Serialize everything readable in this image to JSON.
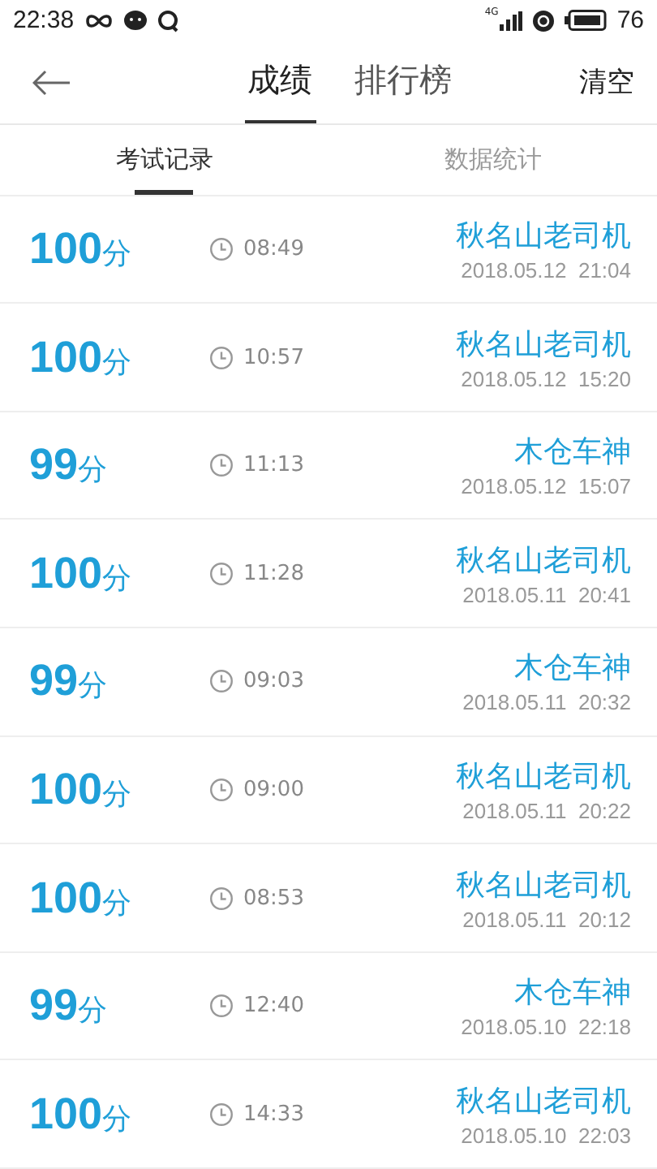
{
  "status_bar": {
    "time": "22:38",
    "network": "4G",
    "battery": "76"
  },
  "header": {
    "tabs": [
      {
        "label": "成绩",
        "selected": true
      },
      {
        "label": "排行榜",
        "selected": false
      }
    ],
    "action": "清空"
  },
  "subtabs": [
    {
      "label": "考试记录",
      "selected": true
    },
    {
      "label": "数据统计",
      "selected": false
    }
  ],
  "records": [
    {
      "score": "100",
      "unit": "分",
      "duration": "08:49",
      "name": "秋名山老司机",
      "date": "2018.05.12  21:04"
    },
    {
      "score": "100",
      "unit": "分",
      "duration": "10:57",
      "name": "秋名山老司机",
      "date": "2018.05.12  15:20"
    },
    {
      "score": "99",
      "unit": "分",
      "duration": "11:13",
      "name": "木仓车神",
      "date": "2018.05.12  15:07"
    },
    {
      "score": "100",
      "unit": "分",
      "duration": "11:28",
      "name": "秋名山老司机",
      "date": "2018.05.11  20:41"
    },
    {
      "score": "99",
      "unit": "分",
      "duration": "09:03",
      "name": "木仓车神",
      "date": "2018.05.11  20:32"
    },
    {
      "score": "100",
      "unit": "分",
      "duration": "09:00",
      "name": "秋名山老司机",
      "date": "2018.05.11  20:22"
    },
    {
      "score": "100",
      "unit": "分",
      "duration": "08:53",
      "name": "秋名山老司机",
      "date": "2018.05.11  20:12"
    },
    {
      "score": "99",
      "unit": "分",
      "duration": "12:40",
      "name": "木仓车神",
      "date": "2018.05.10  22:18"
    },
    {
      "score": "100",
      "unit": "分",
      "duration": "14:33",
      "name": "秋名山老司机",
      "date": "2018.05.10  22:03"
    }
  ]
}
